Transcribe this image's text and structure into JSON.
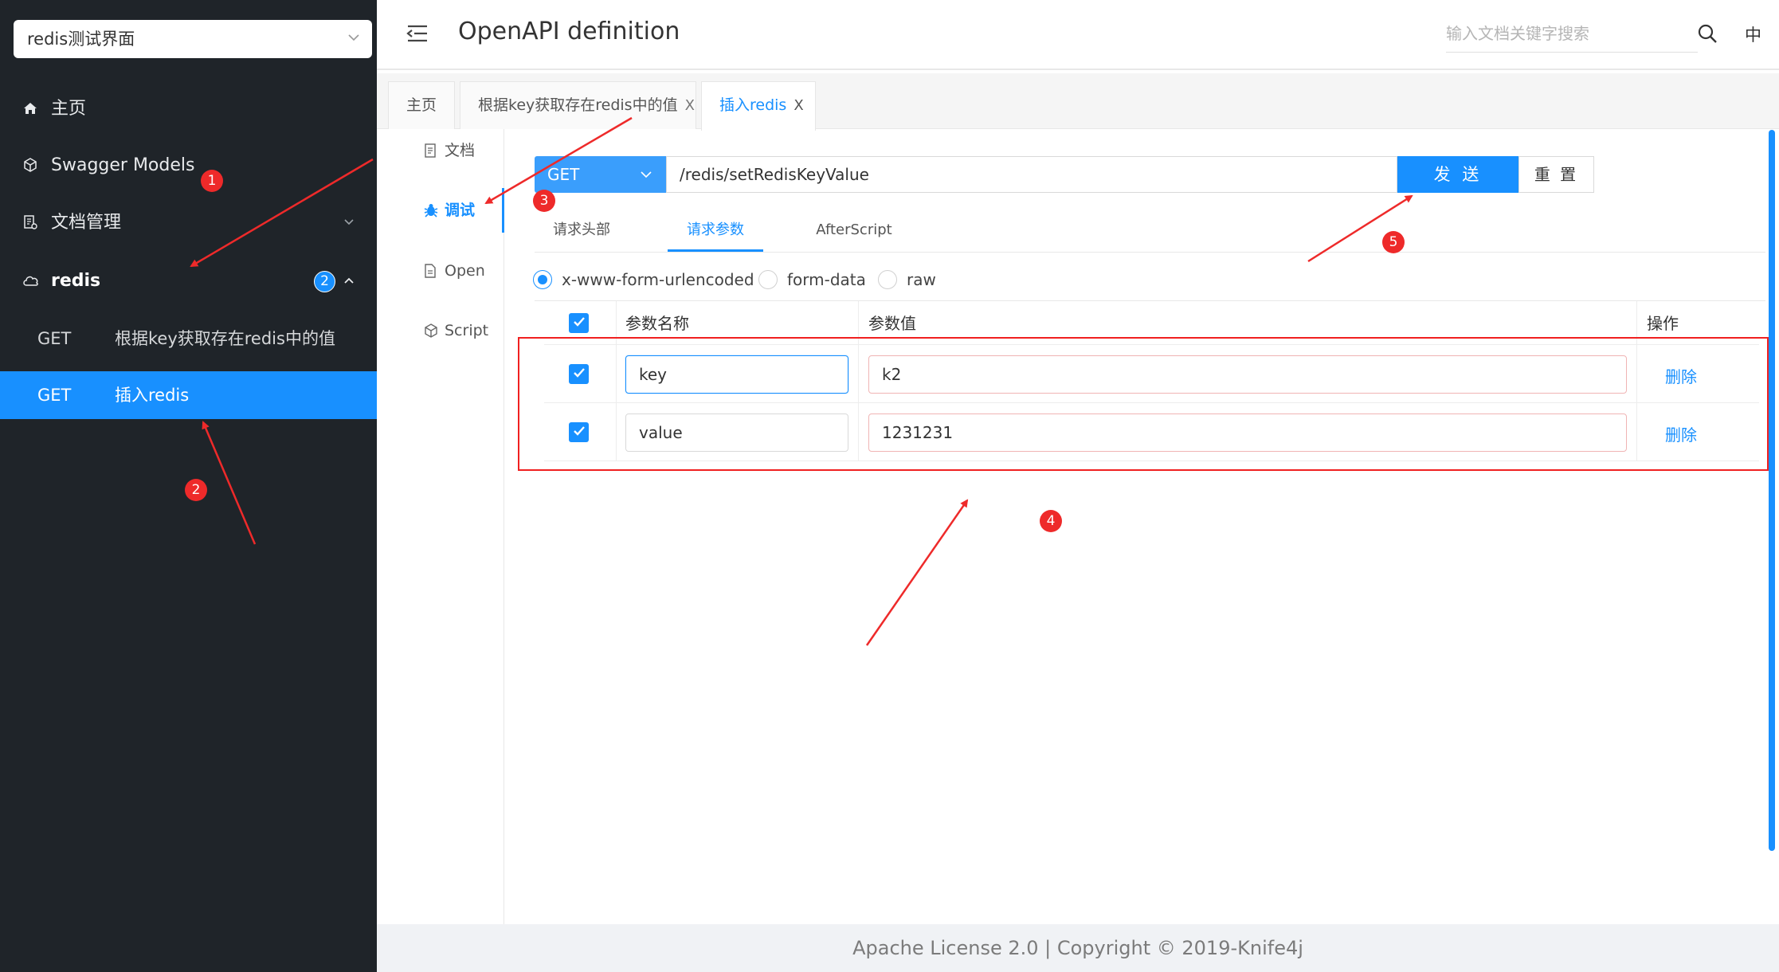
{
  "sidebar": {
    "select_value": "redis测试界面",
    "nav": [
      {
        "label": "主页",
        "icon": "home-icon"
      },
      {
        "label": "Swagger Models",
        "icon": "cube-icon"
      },
      {
        "label": "文档管理",
        "icon": "docs-icon"
      },
      {
        "label": "redis",
        "icon": "cloud-icon",
        "badge": "2"
      }
    ],
    "endpoints": [
      {
        "method": "GET",
        "label": "根据key获取存在redis中的值"
      },
      {
        "method": "GET",
        "label": "插入redis"
      }
    ]
  },
  "header": {
    "title": "OpenAPI definition",
    "search_placeholder": "输入文档关键字搜索",
    "lang": "中"
  },
  "tabs": [
    {
      "label": "主页",
      "closable": false
    },
    {
      "label": "根据key获取存在redis中的值",
      "closable": true,
      "close": "X"
    },
    {
      "label": "插入redis",
      "closable": true,
      "close": "X"
    }
  ],
  "side_tabs": [
    {
      "label": "文档",
      "icon": "document-icon"
    },
    {
      "label": "调试",
      "icon": "bug-icon"
    },
    {
      "label": "Open",
      "icon": "file-icon"
    },
    {
      "label": "Script",
      "icon": "script-icon"
    }
  ],
  "request": {
    "method": "GET",
    "url": "/redis/setRedisKeyValue",
    "send": "发 送",
    "reset": "重 置"
  },
  "subtabs": [
    "请求头部",
    "请求参数",
    "AfterScript"
  ],
  "body_types": [
    "x-www-form-urlencoded",
    "form-data",
    "raw"
  ],
  "params": {
    "headers": {
      "name": "参数名称",
      "value": "参数值",
      "action": "操作"
    },
    "rows": [
      {
        "name": "key",
        "value": "k2",
        "action": "删除"
      },
      {
        "name": "value",
        "value": "1231231",
        "action": "删除"
      }
    ]
  },
  "annotations": [
    "1",
    "2",
    "3",
    "4",
    "5"
  ],
  "footer": "Apache License 2.0 | Copyright © 2019-Knife4j",
  "colors": {
    "accent": "#1890ff",
    "sidebar_bg": "#1f2429",
    "annotation": "#ee2a2a"
  }
}
